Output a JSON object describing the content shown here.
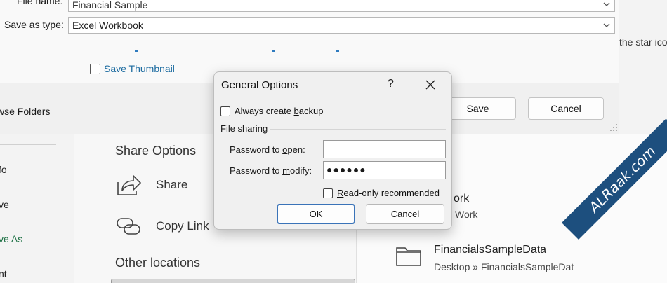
{
  "save_dialog": {
    "file_name_label": "File name:",
    "file_name_value": "Financial Sample",
    "save_type_label": "Save as type:",
    "save_type_value": "Excel Workbook",
    "save_thumbnail_label": "Save Thumbnail",
    "browse_folders_label": "wse Folders",
    "save_button": "Save",
    "cancel_button": "Cancel",
    "star_text": "the star ico"
  },
  "general_options": {
    "title": "General Options",
    "help": "?",
    "always_backup_pre": "Always create ",
    "always_backup_u": "b",
    "always_backup_post": "ackup",
    "file_sharing": "File sharing",
    "password_open_pre": "Password to ",
    "password_open_u": "o",
    "password_open_post": "pen:",
    "password_open_value": "",
    "password_modify_pre": "Password to ",
    "password_modify_u": "m",
    "password_modify_post": "odify:",
    "password_modify_value": "●●●●●●",
    "readonly_pre": "",
    "readonly_u": "R",
    "readonly_post": "ead-only recommended",
    "ok_button": "OK",
    "cancel_button": "Cancel"
  },
  "backstage": {
    "nav": [
      "fo",
      "ve",
      "ve As",
      "nt"
    ],
    "share_options_title": "Share Options",
    "share_label": "Share",
    "copy_link_label": "Copy Link",
    "other_locations_title": "Other locations",
    "work_title": "ork",
    "work_sub": "Work",
    "location_title": "FinancialsSampleData",
    "location_path": "Desktop » FinancialsSampleDat"
  },
  "watermark": "ALRaak.com",
  "colors": {
    "accent_green": "#1e7145",
    "link_blue": "#1c6ba0",
    "primary_border": "#3a73b8"
  }
}
